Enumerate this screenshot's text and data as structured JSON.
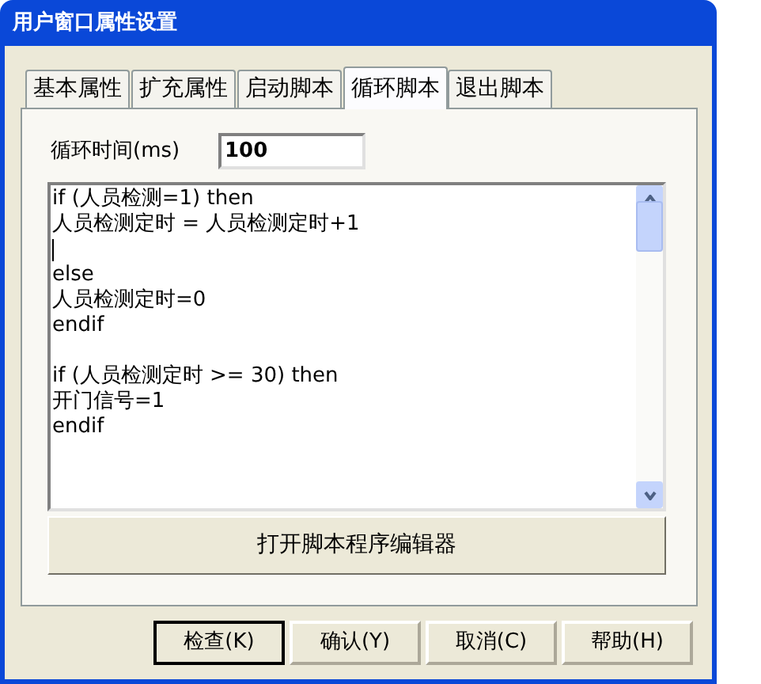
{
  "window": {
    "title": "用户窗口属性设置"
  },
  "tabs": [
    {
      "label": "基本属性",
      "selected": false
    },
    {
      "label": "扩充属性",
      "selected": false
    },
    {
      "label": "启动脚本",
      "selected": false
    },
    {
      "label": "循环脚本",
      "selected": true
    },
    {
      "label": "退出脚本",
      "selected": false
    }
  ],
  "loop_time": {
    "label": "循环时间(ms)",
    "value": "100"
  },
  "script_lines": [
    {
      "kind": "code",
      "text": "if (人员检测=1) then"
    },
    {
      "kind": "code",
      "text": "人员检测定时 = 人员检测定时+1"
    },
    {
      "kind": "caret"
    },
    {
      "kind": "code",
      "text": "else"
    },
    {
      "kind": "code",
      "text": "人员检测定时=0"
    },
    {
      "kind": "code",
      "text": "endif"
    },
    {
      "kind": "blank"
    },
    {
      "kind": "code",
      "text": "if (人员检测定时 >= 30) then"
    },
    {
      "kind": "code",
      "text": "开门信号=1"
    },
    {
      "kind": "code",
      "text": "endif"
    }
  ],
  "editor_button": "打开脚本程序编辑器",
  "buttons": [
    {
      "label": "检查(K)",
      "default": true
    },
    {
      "label": "确认(Y)",
      "default": false
    },
    {
      "label": "取消(C)",
      "default": false
    },
    {
      "label": "帮助(H)",
      "default": false
    }
  ]
}
